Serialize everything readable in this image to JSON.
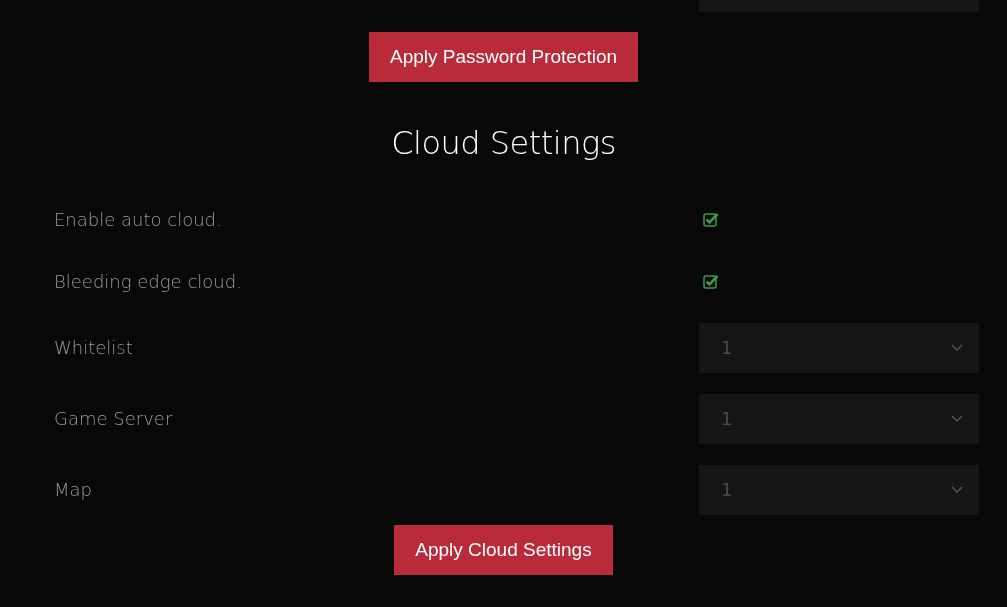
{
  "apply_password_button": "Apply Password Protection",
  "section_title": "Cloud Settings",
  "settings": [
    {
      "kind": "checkbox",
      "label": "Enable auto cloud.",
      "checked": true
    },
    {
      "kind": "checkbox",
      "label": "Bleeding edge cloud.",
      "checked": true
    },
    {
      "kind": "select",
      "label": "Whitelist",
      "value": "1"
    },
    {
      "kind": "select",
      "label": "Game Server",
      "value": "1"
    },
    {
      "kind": "select",
      "label": "Map",
      "value": "1"
    }
  ],
  "apply_cloud_button": "Apply Cloud Settings"
}
